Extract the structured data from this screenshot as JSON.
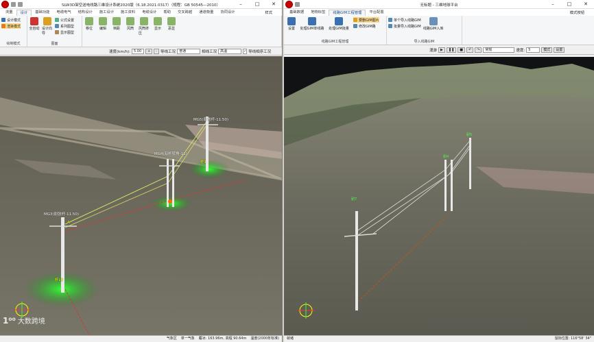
{
  "left": {
    "title": "SLW3D架空送电线路三维设计系统2020版（6.18.2021.0317）（规程：GB 50545—2010）",
    "tabright": "样式",
    "tabs": [
      "浏量",
      "设计",
      "基础功能",
      "电缆电气",
      "结构设计",
      "施工设计",
      "施工资料",
      "电缆设计",
      "帮助",
      "交叉跨越",
      "通道衡量",
      "协同设计"
    ],
    "active_tab": 1,
    "ribbon": {
      "mode_group": {
        "label": "绘制模式",
        "items": [
          "设计模式",
          "渲染模式"
        ]
      },
      "figure_group": {
        "label": "图面",
        "items": [
          "全自动",
          "设计向导"
        ],
        "small": [
          "公式设置",
          "系列图型",
          "显示图型"
        ]
      },
      "buttons": [
        "移位",
        "编辑",
        "档距",
        "风筒",
        "风筒挤压",
        "显示",
        "恶显"
      ]
    },
    "toolbar": {
      "speed_label": "速度(km/h):",
      "speed_value": "5.00",
      "plus": "+",
      "minus": "-",
      "lead_label": "导线工况",
      "lead_value": "普通",
      "phase_label": "相线工况",
      "phase_value": "高温",
      "check_label": "导线相序工况"
    },
    "labels": {
      "mg5": "MG5(耐张杆-11.50)",
      "mg4": "MG4(双杆转角-11)",
      "mg3": "MG3(耐张杆-11.50)",
      "p_a": "A",
      "p_b": "杆1",
      "p_c": "杆L2"
    },
    "status": [
      "气象区",
      "单一气象",
      "覆冰: 163.96m, 高程 90.64m",
      "温度(2000年标准)"
    ]
  },
  "right": {
    "title": "无标题 - 三维地球平台",
    "tabright": "模式按钮",
    "tabs": [
      "基础数据",
      "地物标签",
      "线路GIM工程管理",
      "平台配置"
    ],
    "active_tab": 2,
    "ribbon": {
      "group1": {
        "label": "线路GIM工程管理",
        "items": [
          "设置",
          "处理GIM单线路",
          "处理GIM批量"
        ],
        "small": [
          "要删GIM图片",
          "修改GIM路"
        ]
      },
      "group2": {
        "label": "导入线路GIM",
        "small": [
          "单个导入线路GIM",
          "批量导入线路GIM"
        ],
        "items": [
          "线路GIM入库"
        ]
      }
    },
    "toolbar": {
      "roam_label": "漫游",
      "mode_value": "常规",
      "speed_label": "速度:",
      "speed_value": "5",
      "mode_btn": "模式",
      "set_btn": "设置"
    },
    "labels": {
      "t1": "耐7",
      "t2": "耐4",
      "t3": "耐5"
    },
    "status_left": "就绪",
    "status_right": "鼠标位置: 116°58' 34\""
  },
  "watermark": {
    "logo": "1⁰⁰",
    "text": "大数跨境"
  },
  "colors": {
    "accent": "#1f4f8b",
    "ground": "#6b6a5e",
    "sky": "#111214"
  }
}
